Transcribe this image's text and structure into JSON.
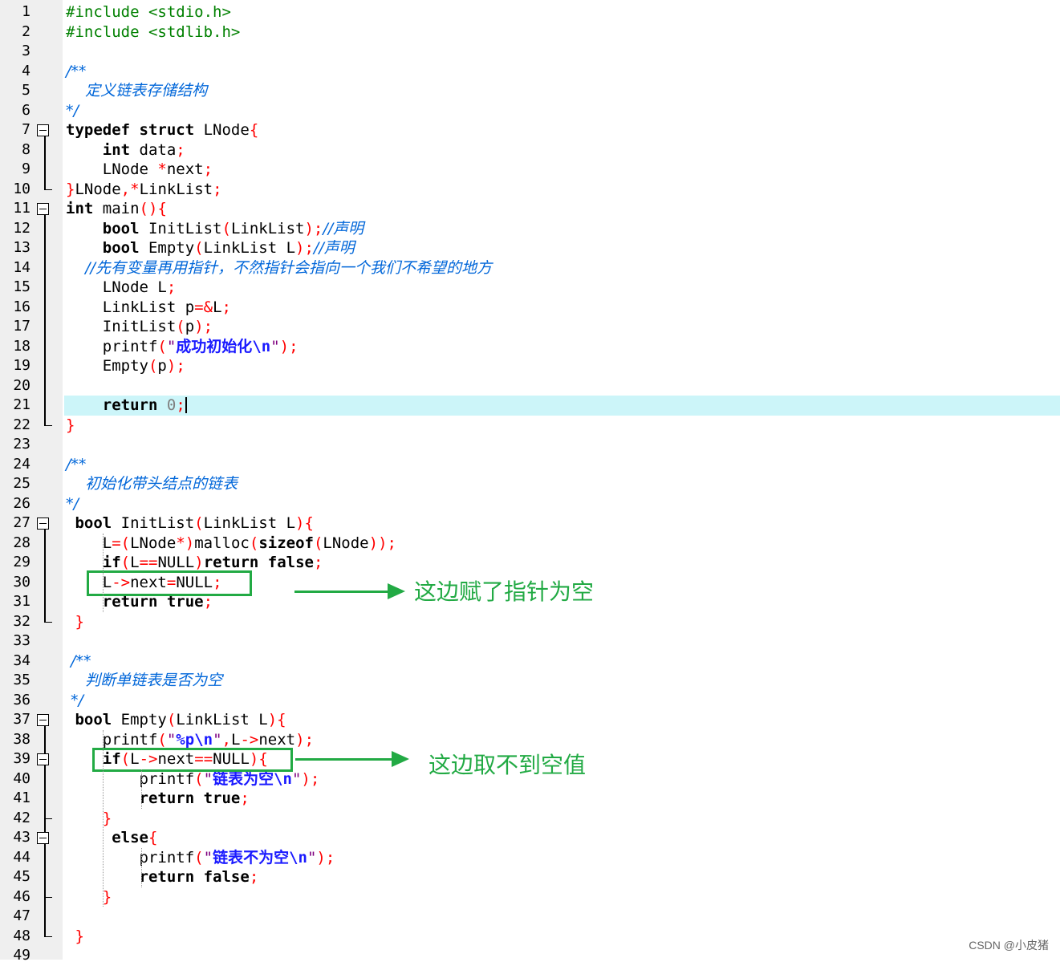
{
  "lines": [
    {
      "n": "1",
      "t": "#include <stdio.h>"
    },
    {
      "n": "2",
      "t": "#include <stdlib.h>"
    },
    {
      "n": "3",
      "t": ""
    },
    {
      "n": "4",
      "t": "/**"
    },
    {
      "n": "5",
      "t": "    定义链表存储结构"
    },
    {
      "n": "6",
      "t": "*/"
    },
    {
      "n": "7",
      "t": "typedef struct LNode{"
    },
    {
      "n": "8",
      "t": "    int data;"
    },
    {
      "n": "9",
      "t": "    LNode *next;"
    },
    {
      "n": "10",
      "t": "}LNode,*LinkList;"
    },
    {
      "n": "11",
      "t": "int main(){"
    },
    {
      "n": "12",
      "t": "    bool InitList(LinkList);//声明"
    },
    {
      "n": "13",
      "t": "    bool Empty(LinkList L);//声明"
    },
    {
      "n": "14",
      "t": "    //先有变量再用指针，不然指针会指向一个我们不希望的地方"
    },
    {
      "n": "15",
      "t": "    LNode L;"
    },
    {
      "n": "16",
      "t": "    LinkList p=&L;"
    },
    {
      "n": "17",
      "t": "    InitList(p);"
    },
    {
      "n": "18",
      "t": "    printf(\"成功初始化\\n\");"
    },
    {
      "n": "19",
      "t": "    Empty(p);"
    },
    {
      "n": "20",
      "t": ""
    },
    {
      "n": "21",
      "t": "    return 0;"
    },
    {
      "n": "22",
      "t": "}"
    },
    {
      "n": "23",
      "t": ""
    },
    {
      "n": "24",
      "t": "/**"
    },
    {
      "n": "25",
      "t": "    初始化带头结点的链表"
    },
    {
      "n": "26",
      "t": "*/"
    },
    {
      "n": "27",
      "t": " bool InitList(LinkList L){"
    },
    {
      "n": "28",
      "t": "    L=(LNode*)malloc(sizeof(LNode));"
    },
    {
      "n": "29",
      "t": "    if(L==NULL)return false;"
    },
    {
      "n": "30",
      "t": "    L->next=NULL;"
    },
    {
      "n": "31",
      "t": "    return true;"
    },
    {
      "n": "32",
      "t": " }"
    },
    {
      "n": "33",
      "t": ""
    },
    {
      "n": "34",
      "t": " /**"
    },
    {
      "n": "35",
      "t": "    判断单链表是否为空"
    },
    {
      "n": "36",
      "t": " */"
    },
    {
      "n": "37",
      "t": " bool Empty(LinkList L){"
    },
    {
      "n": "38",
      "t": "    printf(\"%p\\n\",L->next);"
    },
    {
      "n": "39",
      "t": "    if(L->next==NULL){"
    },
    {
      "n": "40",
      "t": "        printf(\"链表为空\\n\");"
    },
    {
      "n": "41",
      "t": "        return true;"
    },
    {
      "n": "42",
      "t": "    }"
    },
    {
      "n": "43",
      "t": "     else{"
    },
    {
      "n": "44",
      "t": "        printf(\"链表不为空\\n\");"
    },
    {
      "n": "45",
      "t": "        return false;"
    },
    {
      "n": "46",
      "t": "    }"
    },
    {
      "n": "47",
      "t": ""
    },
    {
      "n": "48",
      "t": " }"
    },
    {
      "n": "49",
      "t": ""
    }
  ],
  "annotations": {
    "note1": "这边赋了指针为空",
    "note2": "这边取不到空值"
  },
  "watermark": "CSDN @小皮猪",
  "colors": {
    "highlight": "#ccf5f9",
    "annotation": "#22aa44"
  }
}
